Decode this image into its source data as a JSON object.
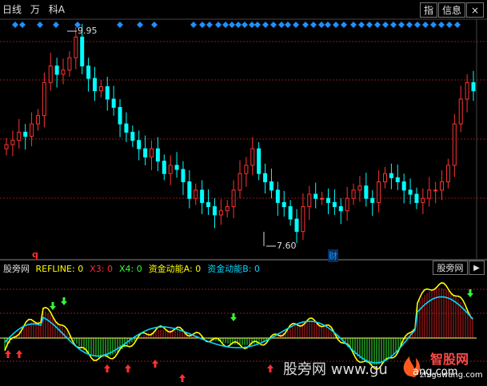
{
  "toolbar": {
    "period": "日线",
    "unit": "万",
    "subject": "科A",
    "btn_indicator": "指",
    "btn_info": "信息",
    "btn_close": "×"
  },
  "main_chart": {
    "high_label": "9.95",
    "low_label": "7.60",
    "marker_q": "q",
    "marker_cai": "财"
  },
  "indicator": {
    "name": "股旁网",
    "fields": [
      {
        "label": "REFLINE:",
        "value": "0",
        "color": "#ffff00"
      },
      {
        "label": "X3:",
        "value": "0",
        "color": "#ff3030"
      },
      {
        "label": "X4:",
        "value": "0",
        "color": "#33ff33"
      },
      {
        "label": "资金动能A:",
        "value": "0",
        "color": "#ffff00"
      },
      {
        "label": "资金动能B:",
        "value": "0",
        "color": "#00d8ff"
      }
    ],
    "button": "股旁网"
  },
  "watermark": {
    "left_text": "股旁网 www.gu",
    "mid_text": "ang.com",
    "right_brand": "智股网",
    "right_url": "zhiguwang.com"
  },
  "colors": {
    "up": "#ff3232",
    "down": "#00ffff",
    "grid": "#8b1a1a",
    "diamond": "#1e90ff",
    "pos_bar": "#c81e1e",
    "neg_bar": "#33ee33",
    "line_a": "#ffff00",
    "line_b": "#00d8ff"
  },
  "chart_data": {
    "type": "candlestick",
    "title": "",
    "price_high": 9.95,
    "price_low": 7.6,
    "close_series": [
      8.65,
      8.7,
      8.8,
      8.75,
      8.9,
      9.0,
      9.4,
      9.6,
      9.5,
      9.55,
      9.7,
      9.95,
      9.6,
      9.45,
      9.3,
      9.35,
      9.2,
      9.1,
      8.9,
      8.8,
      8.7,
      8.6,
      8.5,
      8.6,
      8.45,
      8.3,
      8.4,
      8.35,
      8.2,
      8.0,
      8.1,
      7.95,
      7.9,
      7.8,
      7.85,
      7.9,
      8.1,
      8.3,
      8.4,
      8.6,
      8.3,
      8.2,
      8.1,
      7.95,
      7.9,
      7.75,
      7.6,
      7.9,
      8.05,
      8.0,
      8.0,
      7.95,
      7.9,
      7.85,
      8.0,
      8.1,
      8.15,
      8.0,
      7.95,
      8.2,
      8.3,
      8.25,
      8.2,
      8.1,
      8.05,
      7.95,
      8.0,
      8.1,
      8.1,
      8.2,
      8.4,
      8.9,
      9.2,
      9.4,
      9.3
    ]
  }
}
